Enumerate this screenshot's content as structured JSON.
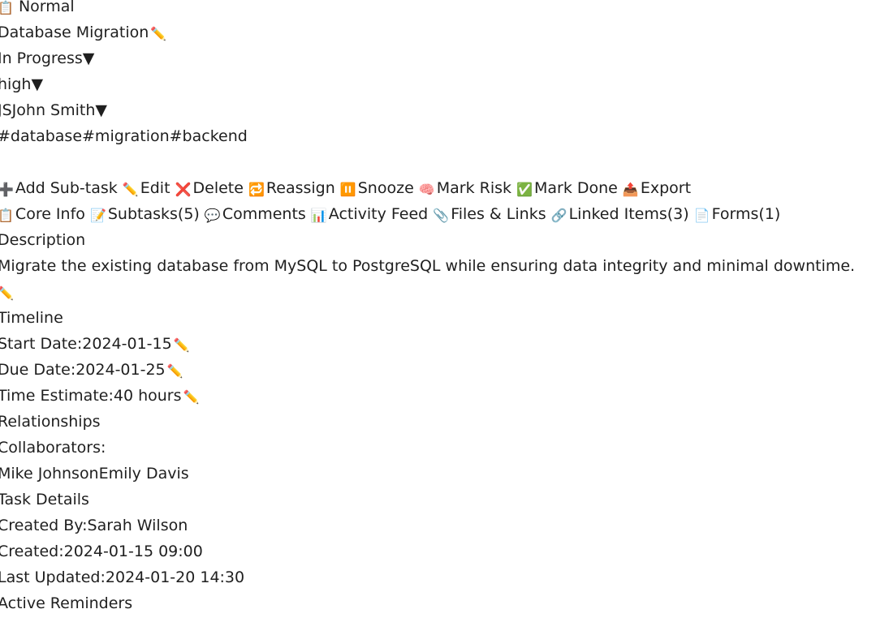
{
  "header": {
    "type": {
      "icon": "clipboard-icon",
      "label": "Normal"
    },
    "title": "Database Migration",
    "status": "In Progress",
    "priority": "high",
    "assignee": {
      "initials": "JS",
      "name": "John Smith"
    },
    "tags": [
      "#database",
      "#migration",
      "#backend"
    ]
  },
  "actions": [
    {
      "label": "Add Sub-task",
      "icon": "plus-icon"
    },
    {
      "label": "Edit",
      "icon": "pencil-icon"
    },
    {
      "label": "Delete",
      "icon": "cross-icon"
    },
    {
      "label": "Reassign",
      "icon": "repeat-icon"
    },
    {
      "label": "Snooze",
      "icon": "pause-icon"
    },
    {
      "label": "Mark Risk",
      "icon": "brain-icon"
    },
    {
      "label": "Mark Done",
      "icon": "check-icon"
    },
    {
      "label": "Export",
      "icon": "outbox-icon"
    }
  ],
  "tabs": [
    {
      "label": "Core Info",
      "icon": "clipboard-icon"
    },
    {
      "label": "Subtasks(5)",
      "icon": "memo-icon"
    },
    {
      "label": "Comments",
      "icon": "speech-bubble-icon"
    },
    {
      "label": "Activity Feed",
      "icon": "bar-chart-icon"
    },
    {
      "label": "Files & Links",
      "icon": "paperclip-icon"
    },
    {
      "label": "Linked Items(3)",
      "icon": "link-icon"
    },
    {
      "label": "Forms(1)",
      "icon": "page-icon"
    }
  ],
  "description": {
    "heading": "Description",
    "text": "Migrate the existing database from MySQL to PostgreSQL while ensuring data integrity and minimal downtime."
  },
  "timeline": {
    "heading": "Timeline",
    "start_label": "Start Date:",
    "start_value": "2024-01-15",
    "due_label": "Due Date:",
    "due_value": "2024-01-25",
    "estimate_label": "Time Estimate:",
    "estimate_value": "40 hours"
  },
  "relationships": {
    "heading": "Relationships",
    "collaborators_label": "Collaborators:",
    "collaborators": [
      "Mike Johnson",
      "Emily Davis"
    ]
  },
  "task_details": {
    "heading": "Task Details",
    "created_by_label": "Created By:",
    "created_by_value": "Sarah Wilson",
    "created_label": "Created:",
    "created_value": "2024-01-15 09:00",
    "updated_label": "Last Updated:",
    "updated_value": "2024-01-20 14:30"
  },
  "reminders": {
    "heading": "Active Reminders"
  }
}
